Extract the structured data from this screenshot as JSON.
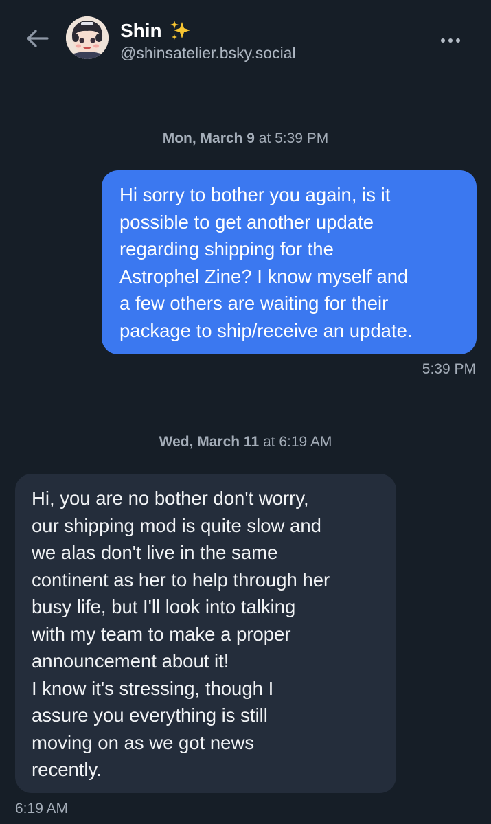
{
  "header": {
    "name": "Shin",
    "handle": "@shinsatelier.bsky.social",
    "back_icon": "arrow-left-icon",
    "more_icon": "ellipsis-icon",
    "sparkles_icon": "sparkles-icon"
  },
  "messages": [
    {
      "date_bold": "Mon, March 9",
      "date_rest": " at 5:39 PM",
      "direction": "sent",
      "lines": [
        "Hi sorry to bother you again, is it",
        "possible to get another update",
        "regarding shipping for the",
        "Astrophel Zine? I know myself and",
        "a few others are waiting for their",
        "package to ship/receive an update."
      ],
      "time": "5:39 PM"
    },
    {
      "date_bold": "Wed, March 11",
      "date_rest": " at 6:19 AM",
      "direction": "received",
      "lines": [
        "Hi, you are no bother don't worry,",
        "our shipping mod is quite slow and",
        "we alas don't live in the same",
        "continent as her to help through her",
        "busy life, but I'll look into talking",
        "with my team to make a proper",
        "announcement about it!",
        "I know it's stressing, though I",
        "assure you everything is still",
        "moving on as we got news",
        "recently."
      ],
      "time": "6:19 AM"
    }
  ],
  "colors": {
    "background": "#161e27",
    "sent_bubble": "#3b78f0",
    "received_bubble": "#242d3b",
    "muted_text": "#a4adb8"
  }
}
